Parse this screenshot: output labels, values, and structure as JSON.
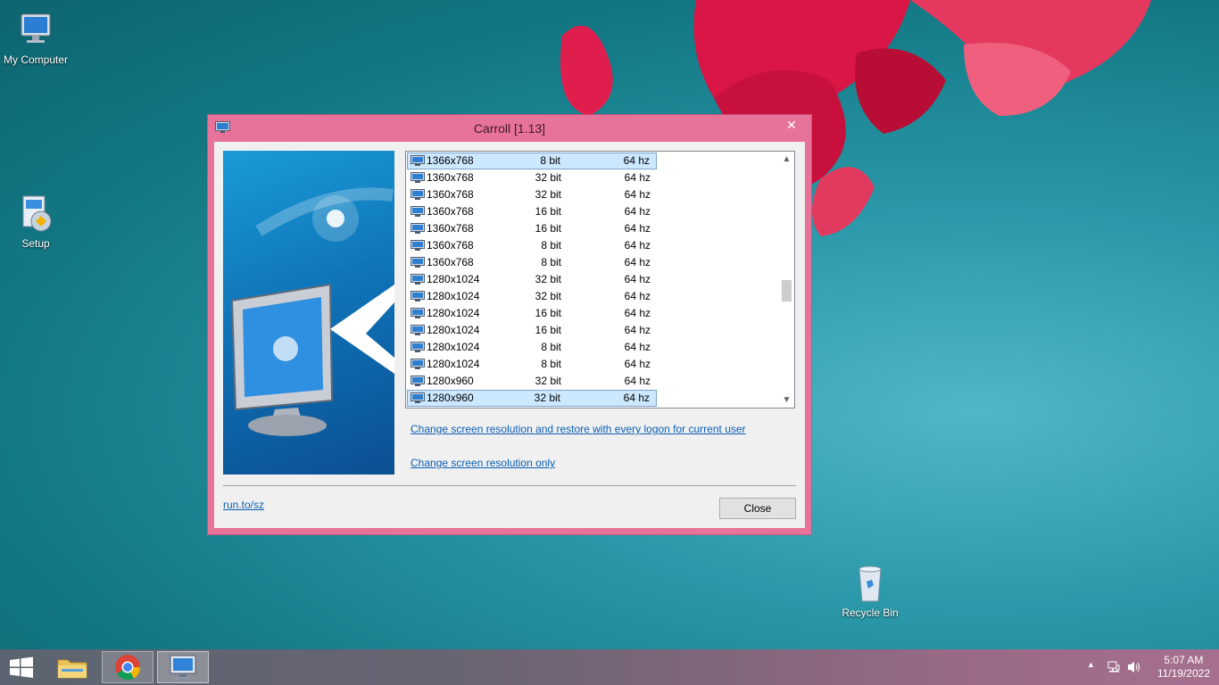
{
  "desktop": {
    "icons": [
      {
        "label": "My Computer"
      },
      {
        "label": "Setup"
      },
      {
        "label": "Recycle Bin"
      }
    ]
  },
  "window": {
    "title": "Carroll [1.13]",
    "close_glyph": "✕",
    "modes": [
      {
        "res": "1366x768",
        "bits": "8 bit",
        "hz": "64 hz",
        "selected": true
      },
      {
        "res": "1360x768",
        "bits": "32 bit",
        "hz": "64 hz"
      },
      {
        "res": "1360x768",
        "bits": "32 bit",
        "hz": "64 hz"
      },
      {
        "res": "1360x768",
        "bits": "16 bit",
        "hz": "64 hz"
      },
      {
        "res": "1360x768",
        "bits": "16 bit",
        "hz": "64 hz"
      },
      {
        "res": "1360x768",
        "bits": "8 bit",
        "hz": "64 hz"
      },
      {
        "res": "1360x768",
        "bits": "8 bit",
        "hz": "64 hz"
      },
      {
        "res": "1280x1024",
        "bits": "32 bit",
        "hz": "64 hz"
      },
      {
        "res": "1280x1024",
        "bits": "32 bit",
        "hz": "64 hz"
      },
      {
        "res": "1280x1024",
        "bits": "16 bit",
        "hz": "64 hz"
      },
      {
        "res": "1280x1024",
        "bits": "16 bit",
        "hz": "64 hz"
      },
      {
        "res": "1280x1024",
        "bits": "8 bit",
        "hz": "64 hz"
      },
      {
        "res": "1280x1024",
        "bits": "8 bit",
        "hz": "64 hz"
      },
      {
        "res": "1280x960",
        "bits": "32 bit",
        "hz": "64 hz"
      },
      {
        "res": "1280x960",
        "bits": "32 bit",
        "hz": "64 hz",
        "focused": true
      }
    ],
    "link_restore": "Change screen resolution and restore with every logon for current user",
    "link_only": "Change screen resolution only",
    "footer_link": "run.to/sz",
    "close_button": "Close"
  },
  "taskbar": {
    "time": "5:07 AM",
    "date": "11/19/2022"
  },
  "colors": {
    "window_frame": "#e8739a",
    "link": "#0b5eb3",
    "selection": "#cce8ff"
  }
}
